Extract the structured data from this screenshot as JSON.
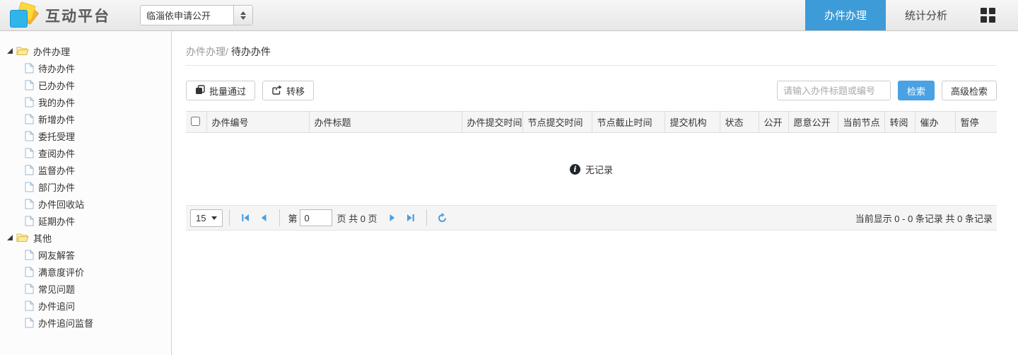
{
  "header": {
    "title": "互动平台",
    "site_select_value": "临淄依申请公开",
    "tabs": [
      {
        "label": "办件办理",
        "active": true
      },
      {
        "label": "统计分析",
        "active": false
      }
    ]
  },
  "sidebar": {
    "tree": [
      {
        "label": "办件办理",
        "children": [
          "待办办件",
          "已办办件",
          "我的办件",
          "新增办件",
          "委托受理",
          "查阅办件",
          "监督办件",
          "部门办件",
          "办件回收站",
          "延期办件"
        ]
      },
      {
        "label": "其他",
        "children": [
          "网友解答",
          "满意度评价",
          "常见问题",
          "办件追问",
          "办件追问监督"
        ]
      }
    ]
  },
  "main": {
    "breadcrumb": {
      "parent": "办件办理/",
      "current": "待办办件"
    },
    "toolbar": {
      "batch_pass_label": "批量通过",
      "transfer_label": "转移",
      "search_placeholder": "请输入办件标题或编号",
      "search_label": "检索",
      "advanced_search_label": "高级检索"
    },
    "table": {
      "columns": [
        "办件编号",
        "办件标题",
        "办件提交时间",
        "节点提交时间",
        "节点截止时间",
        "提交机构",
        "状态",
        "公开",
        "愿意公开",
        "当前节点",
        "转阅",
        "催办",
        "暂停"
      ],
      "empty_text": "无记录",
      "empty_icon": "info-icon"
    },
    "pagination": {
      "page_size": "15",
      "prefix": "第",
      "page_value": "0",
      "suffix": "页 共 0 页",
      "summary": "当前显示 0 - 0 条记录 共 0 条记录"
    }
  },
  "colors": {
    "tab_active": "#3d9bd8",
    "search_button": "#4aa2e4",
    "pager_icon": "#4a9fe0",
    "logo_blue": "#30b4ea",
    "logo_yellow": "#ffd83b"
  }
}
